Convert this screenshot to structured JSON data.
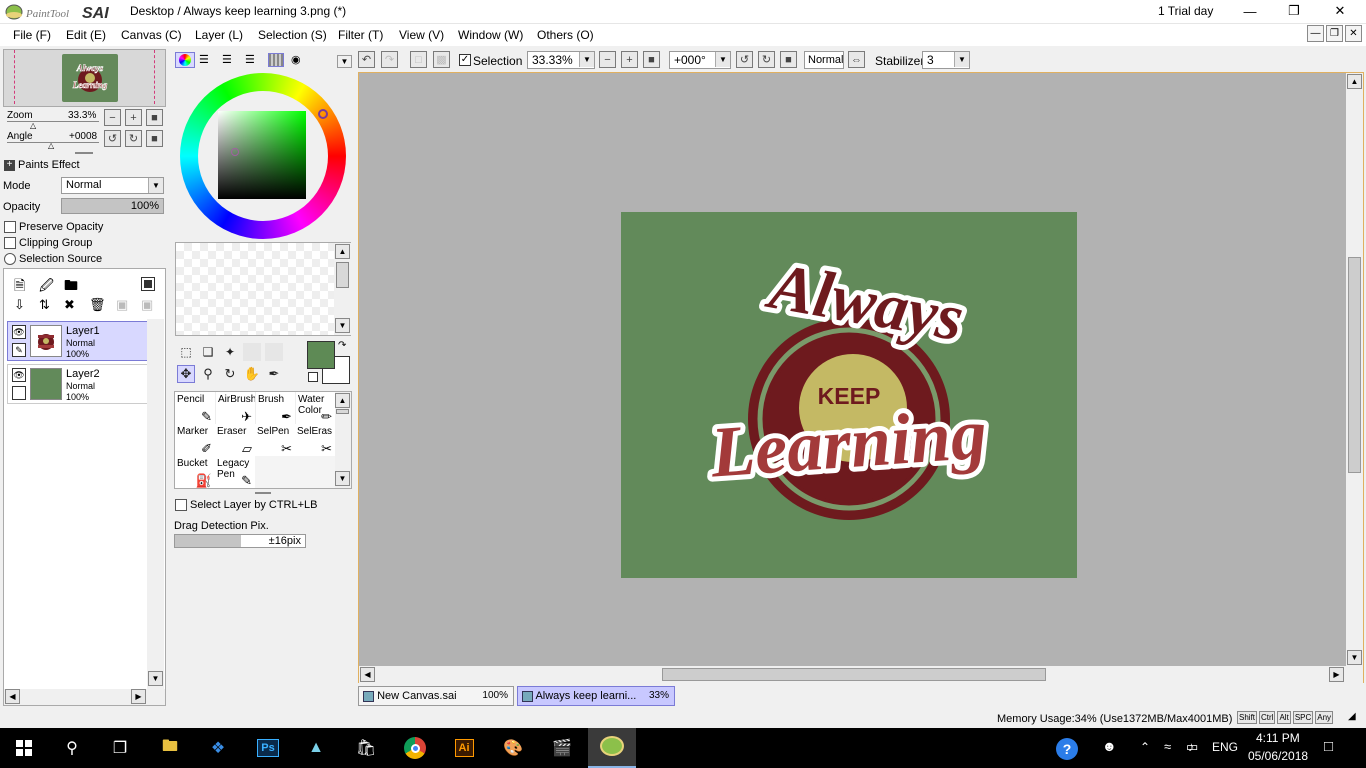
{
  "app": {
    "logo_text": "PaintTool SAI",
    "title": "Desktop / Always keep learning 3.png (*)",
    "trial": "1 Trial day"
  },
  "menu": [
    "File (F)",
    "Edit (E)",
    "Canvas (C)",
    "Layer (L)",
    "Selection (S)",
    "Filter (T)",
    "View (V)",
    "Window (W)",
    "Others (O)"
  ],
  "navigator": {
    "zoom_label": "Zoom",
    "zoom_value": "33.3%",
    "angle_label": "Angle",
    "angle_value": "+0008"
  },
  "layer_props": {
    "paints_effect": "Paints Effect",
    "mode_label": "Mode",
    "mode_value": "Normal",
    "opacity_label": "Opacity",
    "opacity_value": "100%",
    "preserve_opacity": "Preserve Opacity",
    "clipping_group": "Clipping Group",
    "selection_source": "Selection Source"
  },
  "layers": [
    {
      "name": "Layer1",
      "mode": "Normal",
      "opacity": "100%",
      "active": true
    },
    {
      "name": "Layer2",
      "mode": "Normal",
      "opacity": "100%",
      "active": false
    }
  ],
  "toolbar": {
    "selection_label": "Selection",
    "zoom_value": "33.33%",
    "angle_value": "+000°",
    "blend_mode": "Normal",
    "stabilizer_label": "Stabilizer",
    "stabilizer_value": "3"
  },
  "colors": {
    "primary": "#5e8a55",
    "secondary": "#ffffff",
    "canvas_bg": "#628a5a",
    "logo_dark": "#6e1a1e",
    "logo_mid": "#8e2a2f",
    "logo_light": "#c4b964"
  },
  "brushes": [
    {
      "name": "Pencil"
    },
    {
      "name": "AirBrush"
    },
    {
      "name": "Brush"
    },
    {
      "name": "Water Color"
    },
    {
      "name": "Marker"
    },
    {
      "name": "Eraser"
    },
    {
      "name": "SelPen"
    },
    {
      "name": "SelEras"
    },
    {
      "name": "Bucket"
    },
    {
      "name": "Legacy Pen"
    }
  ],
  "tool_options": {
    "select_by_ctrl": "Select Layer by CTRL+LB",
    "drag_detection": "Drag Detection Pix.",
    "drag_value": "±16pix"
  },
  "artwork": {
    "line1": "Always",
    "line2": "KEEP",
    "line3": "Learning"
  },
  "doc_tabs": [
    {
      "name": "New Canvas.sai",
      "zoom": "100%",
      "active": false
    },
    {
      "name": "Always keep learni...",
      "zoom": "33%",
      "active": true
    }
  ],
  "status": {
    "memory": "Memory Usage:34% (Use1372MB/Max4001MB)",
    "keys": [
      "Shift",
      "Ctrl",
      "Alt",
      "SPC",
      "Any"
    ]
  },
  "taskbar": {
    "lang": "ENG",
    "time": "4:11 PM",
    "date": "05/06/2018"
  }
}
